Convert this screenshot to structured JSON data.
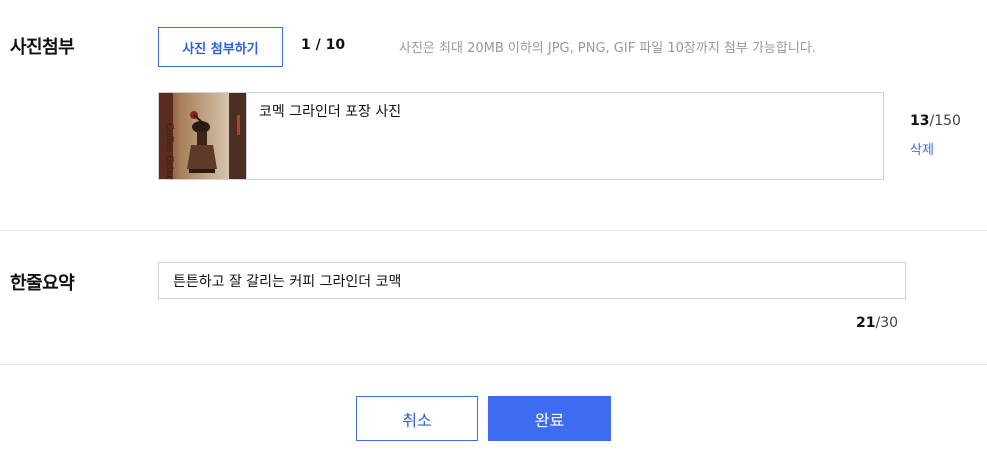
{
  "photo_section": {
    "label": "사진첨부",
    "attach_button": "사진 첨부하기",
    "count_current": "1",
    "count_sep": " / ",
    "count_max": "10",
    "hint": "사진은 최대 20MB 이하의 JPG, PNG, GIF 파일 10장까지 첨부 가능합니다.",
    "items": [
      {
        "thumbnail_icon": "coffee-grinder-photo",
        "caption": "코멕 그라인더 포장 사진",
        "char_current": "13",
        "char_max": "/150",
        "delete_label": "삭제"
      }
    ]
  },
  "summary_section": {
    "label": "한줄요약",
    "value": "튼튼하고 잘 갈리는 커피 그라인더 코맥",
    "char_current": "21",
    "char_max": "/30"
  },
  "actions": {
    "cancel": "취소",
    "done": "완료"
  },
  "colors": {
    "accent": "#3d6cf0",
    "border": "#d4d4d4",
    "divider": "#e2e2e2",
    "hint_text": "#999999"
  }
}
